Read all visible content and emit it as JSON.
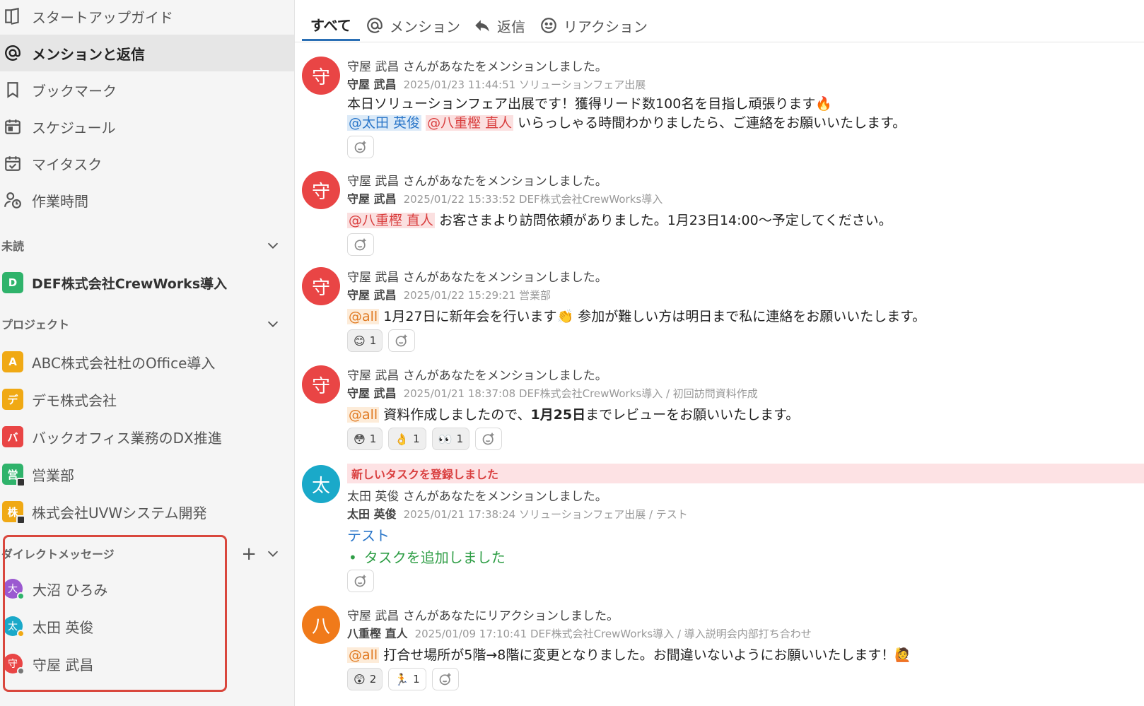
{
  "sidebar": {
    "nav": [
      {
        "label": "スタートアップガイド",
        "icon": "book-icon"
      },
      {
        "label": "メンションと返信",
        "icon": "at-icon",
        "active": true
      },
      {
        "label": "ブックマーク",
        "icon": "bookmark-icon"
      },
      {
        "label": "スケジュール",
        "icon": "calendar-icon"
      },
      {
        "label": "マイタスク",
        "icon": "task-icon"
      },
      {
        "label": "作業時間",
        "icon": "user-clock-icon"
      }
    ],
    "unread": {
      "title": "未読",
      "items": [
        {
          "badge": "D",
          "label": "DEF株式会社CrewWorks導入",
          "color": "#2fb36b"
        }
      ]
    },
    "projects": {
      "title": "プロジェクト",
      "items": [
        {
          "badge": "A",
          "label": "ABC株式会社杜のOffice導入",
          "color": "#f0a914"
        },
        {
          "badge": "デ",
          "label": "デモ株式会社",
          "color": "#f0a914"
        },
        {
          "badge": "バ",
          "label": "バックオフィス業務のDX推進",
          "color": "#e94545"
        },
        {
          "badge": "営",
          "label": "営業部",
          "color": "#2fb36b",
          "locked": true
        },
        {
          "badge": "株",
          "label": "株式会社UVWシステム開発",
          "color": "#f0a914",
          "locked": true
        }
      ]
    },
    "dm": {
      "title": "ダイレクトメッセージ",
      "items": [
        {
          "badge": "大",
          "label": "大沼 ひろみ",
          "color": "#9b59d0",
          "status": "#2fb36b"
        },
        {
          "badge": "太",
          "label": "太田 英俊",
          "color": "#1aa9c9",
          "status": "#f0a914"
        },
        {
          "badge": "守",
          "label": "守屋 武昌",
          "color": "#e94545",
          "status": "#777777"
        }
      ]
    }
  },
  "tabs": [
    {
      "label": "すべて",
      "active": true
    },
    {
      "label": "メンション",
      "icon": "at-icon"
    },
    {
      "label": "返信",
      "icon": "reply-icon"
    },
    {
      "label": "リアクション",
      "icon": "smile-icon"
    }
  ],
  "messages": [
    {
      "avatar": "守",
      "avatar_color": "#e94545",
      "headline": "守屋 武昌 さんがあなたをメンションしました。",
      "author": "守屋 武昌",
      "meta": "2025/01/23 11:44:51  ソリューションフェア出展",
      "body1": "本日ソリューションフェア出展です！獲得リード数100名を目指し頑張ります🔥",
      "mention_a": "@太田 英俊",
      "mention_b": "@八重樫 直人",
      "body2": " いらっしゃる時間わかりましたら、ご連絡をお願いいたします。"
    },
    {
      "avatar": "守",
      "avatar_color": "#e94545",
      "headline": "守屋 武昌 さんがあなたをメンションしました。",
      "author": "守屋 武昌",
      "meta": "2025/01/22 15:33:52  DEF株式会社CrewWorks導入",
      "mention_b": "@八重樫 直人",
      "body": " お客さまより訪問依頼がありました。1月23日14:00～予定してください。"
    },
    {
      "avatar": "守",
      "avatar_color": "#e94545",
      "headline": "守屋 武昌 さんがあなたをメンションしました。",
      "author": "守屋 武昌",
      "meta": "2025/01/22 15:29:21  営業部",
      "mention_all": "@all",
      "body": " 1月27日に新年会を行います👏 参加が難しい方は明日まで私に連絡をお願いいたします。",
      "reactions": [
        {
          "emoji": "😊",
          "count": "1"
        }
      ]
    },
    {
      "avatar": "守",
      "avatar_color": "#e94545",
      "headline": "守屋 武昌 さんがあなたをメンションしました。",
      "author": "守屋 武昌",
      "meta": "2025/01/21 18:37:08  DEF株式会社CrewWorks導入 / 初回訪問資料作成",
      "mention_all": "@all",
      "body_a": " 資料作成しましたので、",
      "body_bold": "1月25日",
      "body_b": "までレビューをお願いいたします。",
      "reactions": [
        {
          "emoji": "😳",
          "count": "1"
        },
        {
          "emoji": "👌",
          "count": "1"
        },
        {
          "emoji": "👀",
          "count": "1"
        }
      ]
    },
    {
      "banner": "新しいタスクを登録しました",
      "avatar": "太",
      "avatar_color": "#1aa9c9",
      "headline": "太田 英俊 さんがあなたをメンションしました。",
      "author": "太田 英俊",
      "meta": "2025/01/21 17:38:24  ソリューションフェア出展 / テスト",
      "link": "テスト",
      "task": "タスクを追加しました"
    },
    {
      "avatar": "八",
      "avatar_color": "#f07a1a",
      "headline": "守屋 武昌 さんがあなたにリアクションしました。",
      "author": "八重樫 直人",
      "meta": "2025/01/09 17:10:41  DEF株式会社CrewWorks導入 / 導入説明会内部打ち合わせ",
      "mention_all": "@all",
      "body": " 打合せ場所が5階→8階に変更となりました。お間違いないようにお願いいたします！🙋",
      "reactions": [
        {
          "emoji": "😲",
          "count": "2"
        },
        {
          "emoji": "🏃",
          "count": "1"
        }
      ]
    }
  ]
}
